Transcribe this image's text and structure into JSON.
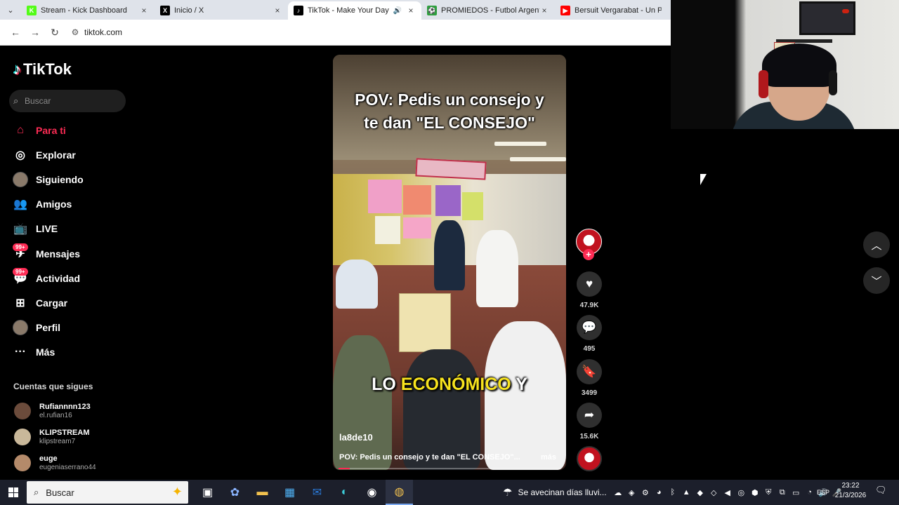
{
  "browser": {
    "tabs": [
      {
        "title": "Stream - Kick Dashboard",
        "favicon": "kick-icon",
        "color": "#53fc18",
        "glyph": "K",
        "active": false,
        "audio": false
      },
      {
        "title": "Inicio / X",
        "favicon": "x-icon",
        "color": "#000000",
        "glyph": "X",
        "active": false,
        "audio": false
      },
      {
        "title": "TikTok - Make Your Day",
        "favicon": "tiktok-icon",
        "color": "#000000",
        "glyph": "♪",
        "active": true,
        "audio": true
      },
      {
        "title": "PROMIEDOS - Futbol Argentino",
        "favicon": "promiedos-icon",
        "color": "#2e9e3e",
        "glyph": "⚽",
        "active": false,
        "audio": false
      },
      {
        "title": "Bersuit Vergarabat - Un Pacto",
        "favicon": "youtube-icon",
        "color": "#ff0000",
        "glyph": "▶",
        "active": false,
        "audio": false
      }
    ],
    "close_glyph": "×",
    "url": "tiktok.com"
  },
  "tiktok": {
    "logo": "TikTok",
    "search_placeholder": "Buscar",
    "nav": [
      {
        "label": "Para ti",
        "icon": "home-icon",
        "glyph": "⌂",
        "active": true,
        "badge": ""
      },
      {
        "label": "Explorar",
        "icon": "compass-icon",
        "glyph": "◎",
        "active": false,
        "badge": ""
      },
      {
        "label": "Siguiendo",
        "icon": "following-avatar-icon",
        "glyph": "",
        "active": false,
        "badge": "",
        "avatar": true
      },
      {
        "label": "Amigos",
        "icon": "friends-icon",
        "glyph": "👥",
        "active": false,
        "badge": ""
      },
      {
        "label": "LIVE",
        "icon": "live-tv-icon",
        "glyph": "📺",
        "active": false,
        "badge": ""
      },
      {
        "label": "Mensajes",
        "icon": "messages-icon",
        "glyph": "✈",
        "active": false,
        "badge": "99+"
      },
      {
        "label": "Actividad",
        "icon": "activity-icon",
        "glyph": "💬",
        "active": false,
        "badge": "99+"
      },
      {
        "label": "Cargar",
        "icon": "upload-icon",
        "glyph": "⊞",
        "active": false,
        "badge": ""
      },
      {
        "label": "Perfil",
        "icon": "profile-avatar-icon",
        "glyph": "",
        "active": false,
        "badge": "",
        "avatar": true
      },
      {
        "label": "Más",
        "icon": "more-icon",
        "glyph": "···",
        "active": false,
        "badge": ""
      }
    ],
    "following_title": "Cuentas que sigues",
    "following": [
      {
        "name": "Rufiannnn123",
        "handle": "el.rufian16",
        "color": "#6b4b3b"
      },
      {
        "name": "KLIPSTREAM",
        "handle": "klipstream7",
        "color": "#c9b89a"
      },
      {
        "name": "euge",
        "handle": "eugeniaserrano44",
        "color": "#b48a6a"
      }
    ]
  },
  "video": {
    "title_line1": "POV: Pedis un consejo y",
    "title_line2": "te dan \"EL CONSEJO\"",
    "caption_pre": "LO ",
    "caption_highlight": "ECONÓMICO",
    "caption_post": " Y",
    "username": "la8de10",
    "description": "POV: Pedis un consejo y te dan \"EL CONSEJO\"...",
    "more": "más",
    "progress": 0.05
  },
  "actions": {
    "likes": "47.9K",
    "comments": "495",
    "saves": "3499",
    "shares": "15.6K"
  },
  "taskbar": {
    "search_placeholder": "Buscar",
    "weather": "Se avecinan días lluvi...",
    "lang": "ESP",
    "time": "23:22",
    "date": "21/3/2026"
  }
}
